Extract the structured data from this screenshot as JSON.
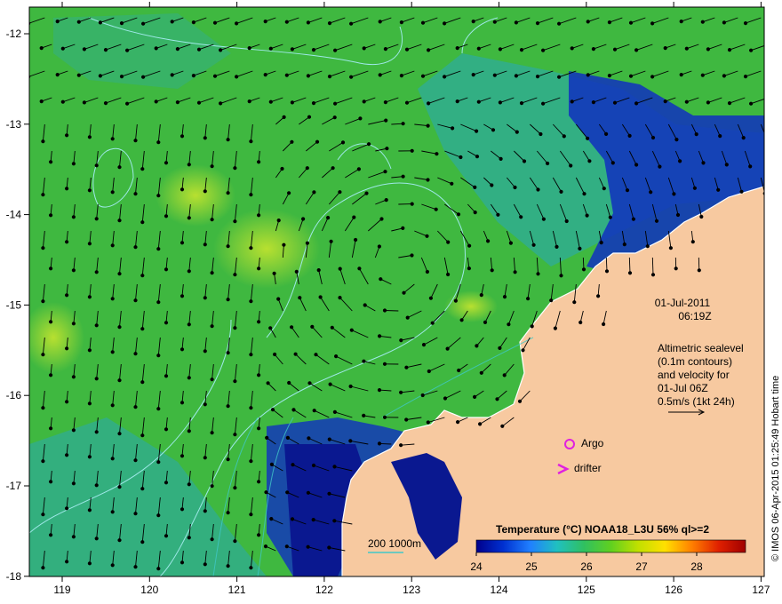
{
  "map": {
    "x_ticks": [
      "119",
      "120",
      "121",
      "122",
      "123",
      "124",
      "125",
      "126",
      "127"
    ],
    "y_ticks": [
      "-12",
      "-13",
      "-14",
      "-15",
      "-16",
      "-17",
      "-18"
    ],
    "lon_range": [
      118.6,
      127
    ],
    "lat_range": [
      -18,
      -11.7
    ]
  },
  "annotation": {
    "date": "01-Jul-2011",
    "time": "06:19Z",
    "alt_line1": "Altimetric sealevel",
    "alt_line2": "(0.1m contours)",
    "alt_line3": "and velocity for",
    "alt_line4": "01-Jul 06Z",
    "alt_line5": "0.5m/s (1kt 24h)"
  },
  "legend": {
    "argo_label": "Argo",
    "drifter_label": "drifter",
    "argo_color": "#e020e0",
    "drifter_color": "#e020e0"
  },
  "depth": {
    "label": "200  1000m",
    "color": "#40c8c8"
  },
  "colorbar": {
    "title": "Temperature (°C) NOAA18_L3U 56% ql>=2",
    "ticks": [
      "24",
      "25",
      "26",
      "27",
      "28"
    ],
    "colors": [
      "#00008b",
      "#0030d0",
      "#2080ff",
      "#20c0c0",
      "#30c060",
      "#60d020",
      "#c0e000",
      "#ffe000",
      "#ff8000",
      "#e02000",
      "#a00000"
    ]
  },
  "credit": "© IMOS 06-Apr-2015 01:25:49 Hobart time",
  "colors": {
    "land": "#f7c9a0",
    "ocean_green": "#3fb840",
    "ocean_cyan": "#2aa8b0",
    "ocean_blue": "#1030c0",
    "ocean_deep": "#0a1890"
  }
}
